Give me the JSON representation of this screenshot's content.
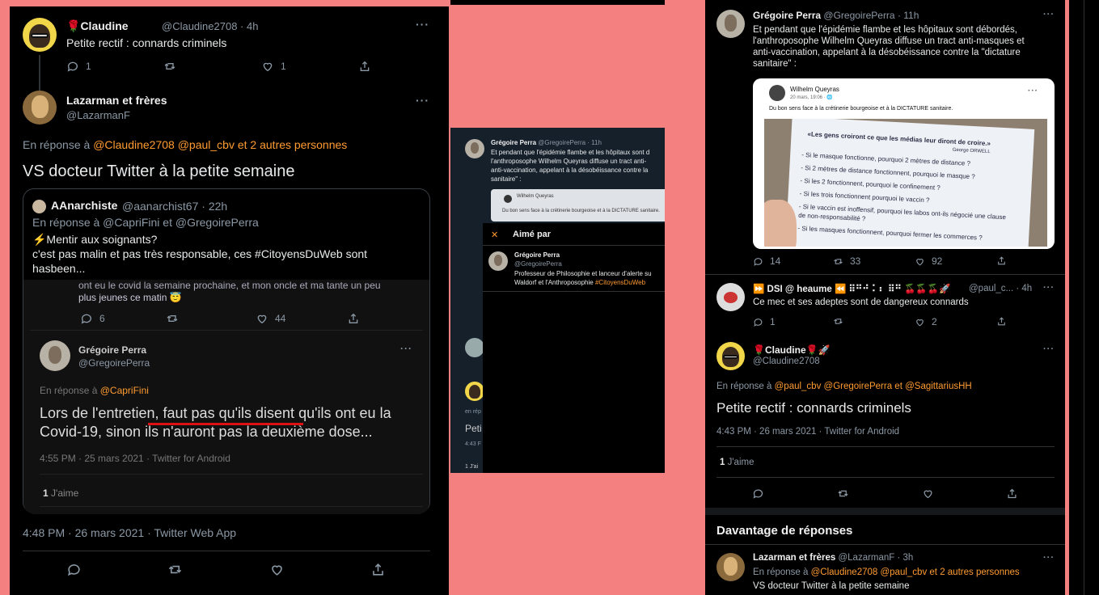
{
  "left": {
    "t1": {
      "name": "Claudine",
      "emoji": "🌹 🚀",
      "handle": "@Claudine2708 · 4h",
      "text": "Petite rectif : connards criminels",
      "replies": "1",
      "likes": "1"
    },
    "t2": {
      "name": "Lazarman et frères",
      "handle": "@LazarmanF",
      "reply_prefix": "En réponse à",
      "m1": "@Claudine2708",
      "m2": "@paul_cbv",
      "m3": "et 2 autres personnes",
      "text": "VS docteur Twitter à la petite semaine"
    },
    "quote": {
      "name": "AAnarchiste",
      "handle": "@aanarchist67 · 22h",
      "reply_line": "En réponse à @CapriFini  et  @GregoirePerra",
      "line1": "⚡Mentir aux soignants?",
      "line2": "c'est pas malin et pas très responsable, ces #CitoyensDuWeb sont",
      "line3": "hasbeen...",
      "cut_line": "ont eu le covid la semaine prochaine, et mon oncle et ma tante un peu",
      "cut_line2": "plus jeunes ce matin 😇",
      "r": "6",
      "l": "44"
    },
    "inner": {
      "name": "Grégoire Perra",
      "handle": "@GregoirePerra",
      "reply_prefix": "En réponse à",
      "mention": "@CapriFini",
      "line1": "Lors de l'entretien, faut pas qu'ils disent qu'ils ont eu la",
      "line2": "Covid-19,  sinon ils n'auront pas la deuxième dose...",
      "meta": "4:55 PM · 25 mars 2021 · Twitter for Android",
      "likes_count": "1",
      "likes_label": "J'aime"
    },
    "meta": "4:48 PM · 26 mars 2021 · Twitter Web App"
  },
  "middle": {
    "name": "Grégoire Perra",
    "handle": "@GregoirePerra · 11h",
    "l1": "Et pendant que l'épidémie flambe et les hôpitaux sont d",
    "l2": "l'anthroposophe Wilhelm Queyras diffuse un tract anti-",
    "l3": "anti-vaccination, appelant à la désobéissance contre la",
    "l4": "sanitaire\" :",
    "embed_name": "Wilhelm Queyras",
    "embed_text": "Du bon sens face à la crétinerie bourgeoise et à la DICTATURE sanitaire.",
    "modal_title": "Aimé par",
    "modal_close": "✕",
    "user_name": "Grégoire Perra",
    "user_handle": "@GregoirePerra",
    "user_bio1": "Professeur de Philosophie et lanceur d'alerte su",
    "user_bio2": "Waldorf et l'Anthroposophie",
    "user_tag": "#CitoyensDuWeb",
    "bg1": "en rép",
    "bg2": "Peti",
    "bg3": "4:43 F",
    "bg4": "1 J'ai"
  },
  "right": {
    "t1": {
      "name": "Grégoire Perra",
      "handle": "@GregoirePerra · 11h",
      "l1": "Et pendant que l'épidémie flambe et les hôpitaux sont débordés,",
      "l2": "l'anthroposophe Wilhelm Queyras diffuse un tract anti-masques et",
      "l3": "anti-vaccination, appelant à la désobéissance contre la \"dictature",
      "l4": "sanitaire\" :",
      "replies": "14",
      "rts": "33",
      "likes": "92"
    },
    "embed": {
      "name": "Wilhelm Queyras",
      "date": "20 mars, 19:06 · 🌐",
      "text": "Du bon sens face à la crétinerie bourgeoise et à la DICTATURE sanitaire.",
      "paper": [
        "«Les gens croiront ce que les médias leur diront de croire.»",
        "George ORWELL",
        "- Si le masque fonctionne, pourquoi 2 mètres de distance ?",
        "- Si 2 mètres de distance fonctionnent, pourquoi le masque ?",
        "- Si les 2 fonctionnent, pourquoi le confinement ?",
        "- Si les trois fonctionnent pourquoi le vaccin ?",
        "- Si le vaccin est inoffensif, pourquoi les labos ont-ils négocié une clause",
        "  de non-responsabilité ?",
        "- Si les masques fonctionnent, pourquoi fermer les commerces ?"
      ]
    },
    "t2": {
      "name": "⏩ DSI @ heaume ⏪ ⠿⠛⠚ ⠅⠆ ⠿⠛ 🍒🍒🍒🚀",
      "handle": "@paul_c... · 4h",
      "text": "Ce mec et ses adeptes sont de dangereux connards",
      "replies": "1",
      "likes": "2"
    },
    "t3": {
      "name": "🌹Claudine🌹🚀",
      "handle": "@Claudine2708",
      "reply_prefix": "En réponse à",
      "m1": "@paul_cbv",
      "m2": "@GregoirePerra",
      "et": "et",
      "m3": "@SagittariusHH",
      "text": "Petite rectif : connards criminels",
      "meta": "4:43 PM · 26 mars 2021 · Twitter for Android",
      "likes_count": "1",
      "likes_label": "J'aime"
    },
    "more": "Davantage de réponses",
    "t4": {
      "name": "Lazarman et frères",
      "handle": "@LazarmanF · 3h",
      "reply_prefix": "En réponse à",
      "m1": "@Claudine2708",
      "m2": "@paul_cbv",
      "m3": "et 2 autres personnes",
      "text": "VS docteur Twitter à la petite semaine"
    }
  },
  "colors": {
    "background": "#f48080",
    "mention": "#ff9b30",
    "panel": "#000000"
  }
}
